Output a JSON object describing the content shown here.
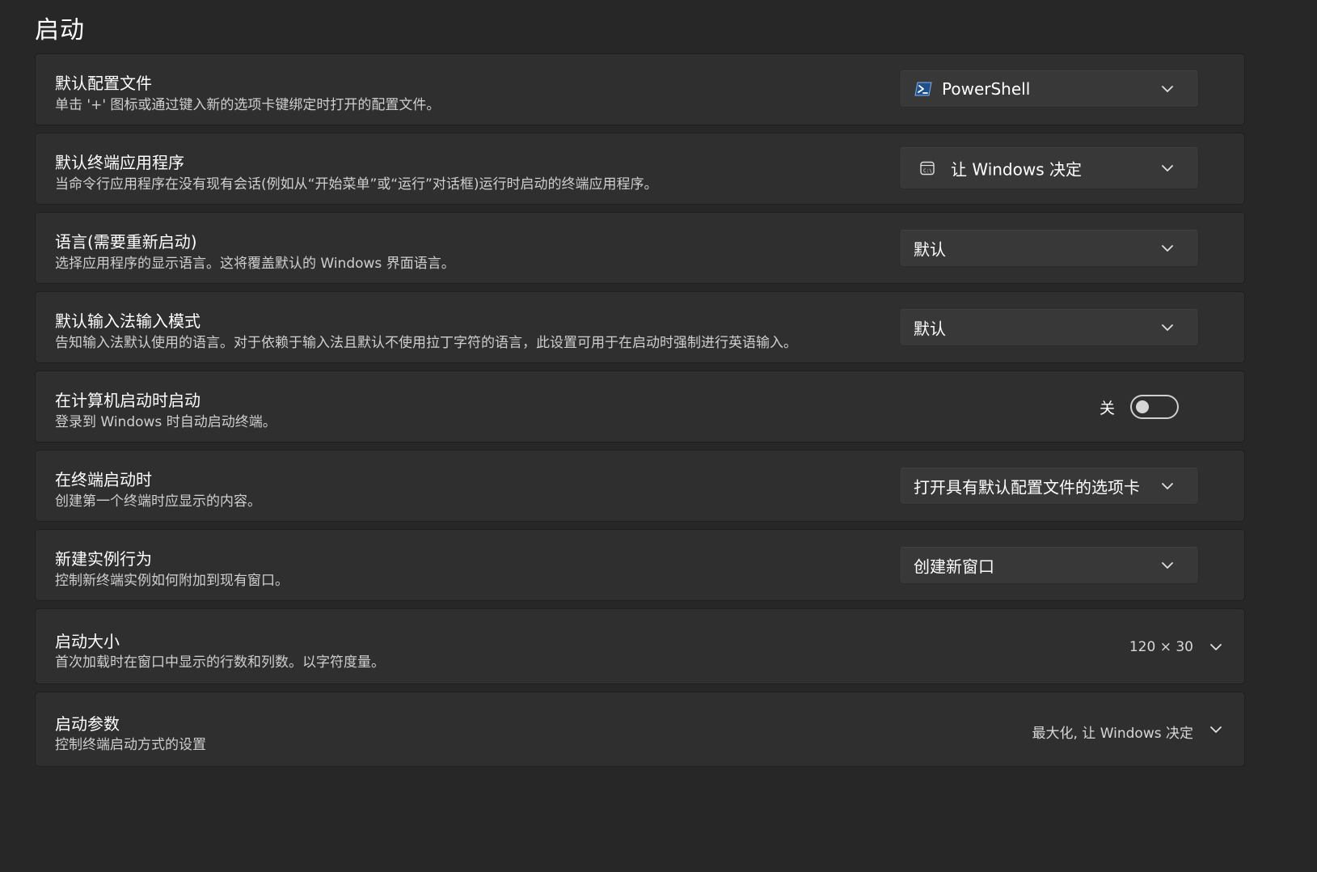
{
  "page": {
    "title": "启动"
  },
  "settings": [
    {
      "title": "默认配置文件",
      "description": "单击 '+' 图标或通过键入新的选项卡键绑定时打开的配置文件。",
      "control": "dropdown",
      "icon": "powershell-icon",
      "value": "PowerShell"
    },
    {
      "title": "默认终端应用程序",
      "description": "当命令行应用程序在没有现有会话(例如从“开始菜单”或“运行”对话框)运行时启动的终端应用程序。",
      "control": "dropdown",
      "icon": "console-window-icon",
      "value": "让 Windows 决定"
    },
    {
      "title": "语言(需要重新启动)",
      "description": "选择应用程序的显示语言。这将覆盖默认的 Windows 界面语言。",
      "control": "dropdown",
      "value": "默认"
    },
    {
      "title": "默认输入法输入模式",
      "description": "告知输入法默认使用的语言。对于依赖于输入法且默认不使用拉丁字符的语言，此设置可用于在启动时强制进行英语输入。",
      "control": "dropdown",
      "value": "默认"
    },
    {
      "title": "在计算机启动时启动",
      "description": "登录到 Windows 时自动启动终端。",
      "control": "toggle",
      "state_label": "关",
      "checked": false
    },
    {
      "title": "在终端启动时",
      "description": "创建第一个终端时应显示的内容。",
      "control": "dropdown",
      "value": "打开具有默认配置文件的选项卡"
    },
    {
      "title": "新建实例行为",
      "description": "控制新终端实例如何附加到现有窗口。",
      "control": "dropdown",
      "value": "创建新窗口"
    },
    {
      "title": "启动大小",
      "description": "首次加载时在窗口中显示的行数和列数。以字符度量。",
      "control": "expander",
      "value": "120 × 30"
    },
    {
      "title": "启动参数",
      "description": "控制终端启动方式的设置",
      "control": "expander",
      "value": "最大化, 让 Windows 决定"
    }
  ],
  "colors": {
    "background": "#272727",
    "card": "#2f2f2f",
    "dropdown": "#383838",
    "text": "#ffffff",
    "secondary_text": "#cfcfcf"
  }
}
